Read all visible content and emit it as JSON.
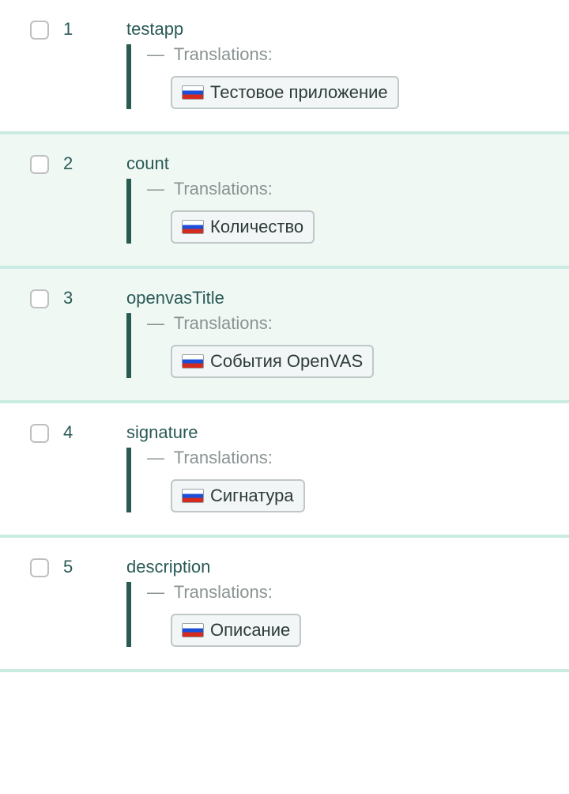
{
  "labels": {
    "translations_prefix": "—",
    "translations_word": "Translations:"
  },
  "rows": [
    {
      "index": "1",
      "key": "testapp",
      "translation_lang": "ru",
      "translation_text": "Тестовое приложение",
      "alt": false
    },
    {
      "index": "2",
      "key": "count",
      "translation_lang": "ru",
      "translation_text": "Количество",
      "alt": true
    },
    {
      "index": "3",
      "key": "openvasTitle",
      "translation_lang": "ru",
      "translation_text": "События OpenVAS",
      "alt": true
    },
    {
      "index": "4",
      "key": "signature",
      "translation_lang": "ru",
      "translation_text": "Сигнатура",
      "alt": false
    },
    {
      "index": "5",
      "key": "description",
      "translation_lang": "ru",
      "translation_text": "Описание",
      "alt": false
    }
  ]
}
